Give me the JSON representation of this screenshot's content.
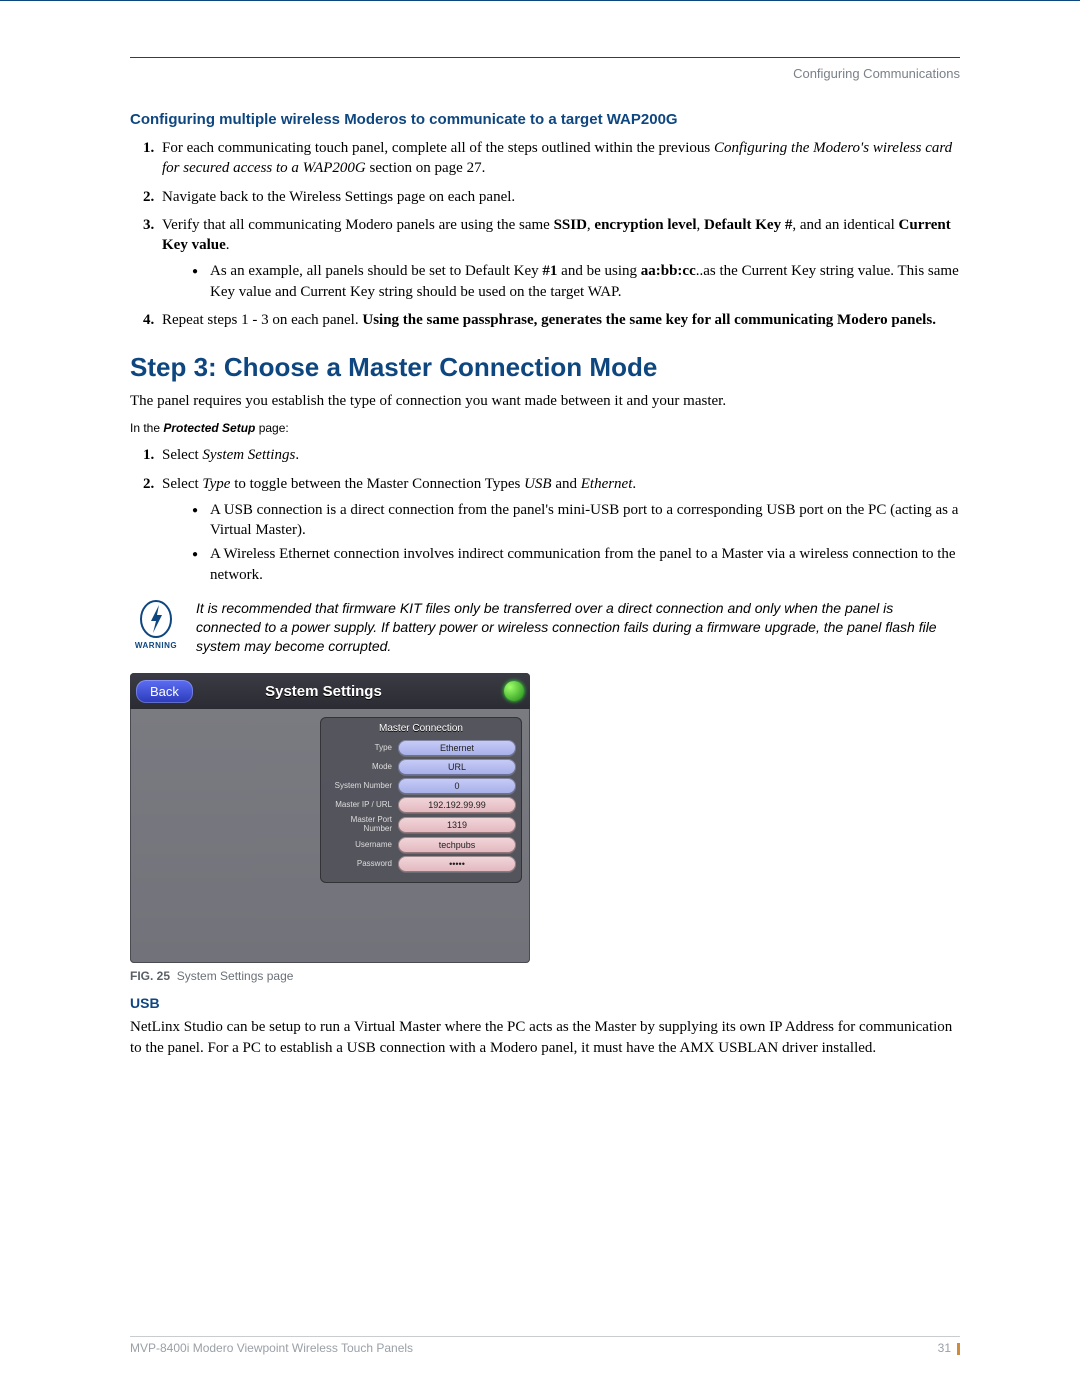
{
  "header": {
    "section": "Configuring Communications"
  },
  "sec1": {
    "title": "Configuring multiple wireless Moderos to communicate to a target WAP200G",
    "li1_a": "For each communicating touch panel, complete all of the steps outlined within the previous ",
    "li1_b": "Configuring the Modero's wireless card for secured access to a WAP200G",
    "li1_c": " section on page 27.",
    "li2": "Navigate back to the Wireless Settings page on each panel.",
    "li3_a": "Verify that all communicating Modero panels are using the same ",
    "li3_b": "SSID",
    "li3_c": ", ",
    "li3_d": "encryption level",
    "li3_e": ", ",
    "li3_f": "Default Key #",
    "li3_g": ", and an identical ",
    "li3_h": "Current Key value",
    "li3_i": ".",
    "li3_sub_a": "As an example, all panels should be set to Default Key ",
    "li3_sub_b": "#1",
    "li3_sub_c": " and be using ",
    "li3_sub_d": "aa:bb:cc",
    "li3_sub_e": "..as the Current Key string value. This same Key value and Current Key string should be used on the target WAP.",
    "li4_a": "Repeat steps 1 - 3 on each panel. ",
    "li4_b": "Using the same passphrase, generates the same key for all communicating Modero panels."
  },
  "step3": {
    "heading": "Step 3: Choose a Master Connection Mode",
    "intro": "The panel requires you establish the type of connection you want made between it and your master.",
    "note_a": "In the ",
    "note_b": "Protected Setup",
    "note_c": " page:",
    "li1_a": "Select ",
    "li1_b": "System Settings",
    "li1_c": ".",
    "li2_a": "Select ",
    "li2_b": "Type",
    "li2_c": " to toggle between the Master Connection Types ",
    "li2_d": "USB",
    "li2_e": " and ",
    "li2_f": "Ethernet",
    "li2_g": ".",
    "sub1": "A USB connection is a direct connection from the panel's mini-USB port to a corresponding USB port on the PC (acting as a Virtual Master).",
    "sub2": "A Wireless Ethernet connection involves indirect communication from the panel to a Master via a wireless connection to the network."
  },
  "warning": {
    "label": "WARNING",
    "text": "It is recommended that firmware KIT files only be transferred over a direct connection and only when the panel is connected to a power supply. If battery power or wireless connection fails during a firmware upgrade, the panel flash file system may become corrupted."
  },
  "screenshot": {
    "back": "Back",
    "title": "System Settings",
    "panel_title": "Master Connection",
    "rows": {
      "type_label": "Type",
      "type_value": "Ethernet",
      "mode_label": "Mode",
      "mode_value": "URL",
      "sysnum_label": "System Number",
      "sysnum_value": "0",
      "ip_label": "Master IP / URL",
      "ip_value": "192.192.99.99",
      "port_label": "Master Port Number",
      "port_value": "1319",
      "user_label": "Username",
      "user_value": "techpubs",
      "pass_label": "Password",
      "pass_value": "•••••"
    }
  },
  "figure": {
    "num": "FIG. 25",
    "caption": "System Settings page"
  },
  "usb": {
    "heading": "USB",
    "para": "NetLinx Studio can be setup to run a Virtual Master where the PC acts as the Master by supplying its own IP Address for communication to the panel. For a PC to establish a USB connection with a Modero panel, it must have the AMX USBLAN driver installed."
  },
  "footer": {
    "doc": "MVP-8400i Modero Viewpoint Wireless Touch Panels",
    "page": "31"
  }
}
